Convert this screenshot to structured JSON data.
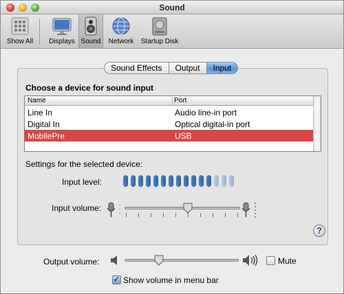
{
  "window": {
    "title": "Sound"
  },
  "toolbar": {
    "items": [
      {
        "label": "Show All",
        "icon": "apple-grid-icon"
      },
      {
        "label": "Displays",
        "icon": "display-icon"
      },
      {
        "label": "Sound",
        "icon": "speaker-icon",
        "selected": true
      },
      {
        "label": "Network",
        "icon": "network-globe-icon"
      },
      {
        "label": "Startup Disk",
        "icon": "hard-disk-icon"
      }
    ]
  },
  "tabs": [
    {
      "label": "Sound Effects",
      "active": false
    },
    {
      "label": "Output",
      "active": false
    },
    {
      "label": "Input",
      "active": true
    }
  ],
  "input": {
    "heading": "Choose a device for sound input",
    "columns": [
      "Name",
      "Port"
    ],
    "rows": [
      {
        "name": "Line In",
        "port": "Audio line-in port",
        "selected": false
      },
      {
        "name": "Digital In",
        "port": "Optical digital-in port",
        "selected": false
      },
      {
        "name": "MobilePre",
        "port": "USB",
        "selected": true
      }
    ],
    "settings_label": "Settings for the selected device:",
    "input_level_label": "Input level:",
    "input_level": {
      "segments": 15,
      "lit": 12
    },
    "input_volume_label": "Input volume:",
    "input_volume": 0.55
  },
  "output": {
    "volume_label": "Output volume:",
    "volume": 0.3,
    "mute_label": "Mute",
    "mute_checked": false,
    "show_in_menubar_label": "Show volume in menu bar",
    "show_in_menubar_checked": true
  },
  "help": {
    "glyph": "?"
  },
  "colors": {
    "selection": "#d84648",
    "tab_active": "#5c93d6",
    "meter_on": "#2d5d9f",
    "meter_off": "#98b2d0"
  }
}
